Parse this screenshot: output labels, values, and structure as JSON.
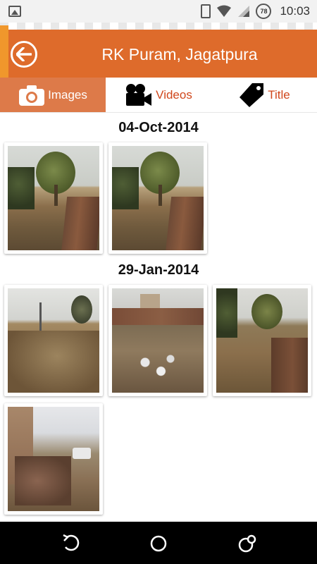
{
  "status_bar": {
    "time": "10:03",
    "battery_level": "78"
  },
  "app_bar": {
    "title": "RK Puram, Jagatpura",
    "back_icon": "back-arrow-icon"
  },
  "tabs": [
    {
      "label": "Images",
      "icon": "camera-icon",
      "active": true
    },
    {
      "label": "Videos",
      "icon": "video-camera-icon",
      "active": false
    },
    {
      "label": "Title",
      "icon": "tag-icon",
      "active": false
    }
  ],
  "groups": [
    {
      "date": "04-Oct-2014",
      "photo_count": 2
    },
    {
      "date": "29-Jan-2014",
      "photo_count": 4
    }
  ],
  "colors": {
    "app_bar": "#de6b2b",
    "active_tab": "#dd7a49",
    "tab_text": "#d0471c"
  }
}
